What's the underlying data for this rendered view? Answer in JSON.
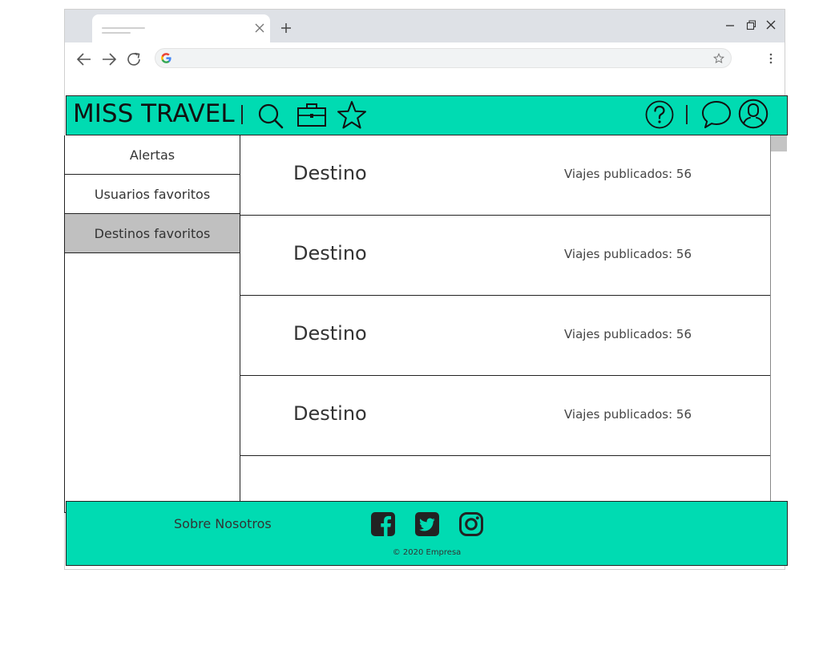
{
  "site": {
    "brand": "MISS TRAVEL"
  },
  "sidebar": {
    "items": [
      {
        "label": "Alertas",
        "active": false
      },
      {
        "label": "Usuarios favoritos",
        "active": false
      },
      {
        "label": "Destinos favoritos",
        "active": true
      }
    ]
  },
  "destinations": [
    {
      "name": "Destino",
      "count_text": "Viajes publicados: 56"
    },
    {
      "name": "Destino",
      "count_text": "Viajes publicados: 56"
    },
    {
      "name": "Destino",
      "count_text": "Viajes publicados: 56"
    },
    {
      "name": "Destino",
      "count_text": "Viajes publicados: 56"
    }
  ],
  "footer": {
    "about_label": "Sobre Nosotros",
    "copyright": "© 2020 Empresa"
  },
  "colors": {
    "accent": "#00dbb2",
    "sidebar_active": "#c0c0c0"
  },
  "icons": {
    "header": [
      "search-icon",
      "briefcase-icon",
      "star-icon",
      "help-icon",
      "chat-icon",
      "user-icon"
    ],
    "footer": [
      "facebook-icon",
      "twitter-icon",
      "instagram-icon"
    ]
  }
}
